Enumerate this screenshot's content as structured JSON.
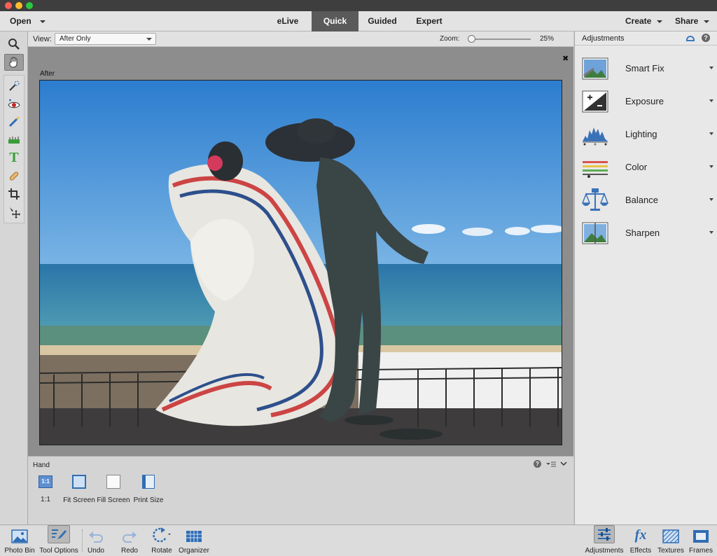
{
  "menubar": {
    "open_label": "Open",
    "modes": [
      {
        "label": "eLive",
        "active": false
      },
      {
        "label": "Quick",
        "active": true
      },
      {
        "label": "Guided",
        "active": false
      },
      {
        "label": "Expert",
        "active": false
      }
    ],
    "create_label": "Create",
    "share_label": "Share"
  },
  "options": {
    "view_label": "View:",
    "view_value": "After Only",
    "zoom_label": "Zoom:",
    "zoom_value": "25%",
    "zoom_fraction": 0.05
  },
  "canvas": {
    "after_label": "After",
    "close_glyph": "✖"
  },
  "tool_options": {
    "tool_name": "Hand",
    "items": [
      {
        "label": "1:1",
        "icon_text": "1:1"
      },
      {
        "label": "Fit Screen"
      },
      {
        "label": "Fill Screen"
      },
      {
        "label": "Print Size"
      }
    ]
  },
  "adjustments": {
    "title": "Adjustments",
    "items": [
      {
        "label": "Smart Fix",
        "icon": "smart-fix-icon"
      },
      {
        "label": "Exposure",
        "icon": "exposure-icon"
      },
      {
        "label": "Lighting",
        "icon": "lighting-icon"
      },
      {
        "label": "Color",
        "icon": "color-icon"
      },
      {
        "label": "Balance",
        "icon": "balance-icon"
      },
      {
        "label": "Sharpen",
        "icon": "sharpen-icon"
      }
    ]
  },
  "taskbar": {
    "photo_bin": "Photo Bin",
    "tool_options": "Tool Options",
    "undo": "Undo",
    "redo": "Redo",
    "rotate": "Rotate",
    "organizer": "Organizer",
    "adjustments": "Adjustments",
    "effects": "Effects",
    "textures": "Textures",
    "frames": "Frames",
    "effects_glyph": "fx"
  },
  "colors": {
    "active_tab": "#5a5a5a",
    "icon_blue": "#2f6db3",
    "sky": "#4a90d0",
    "sea": "#2f7aa6"
  }
}
